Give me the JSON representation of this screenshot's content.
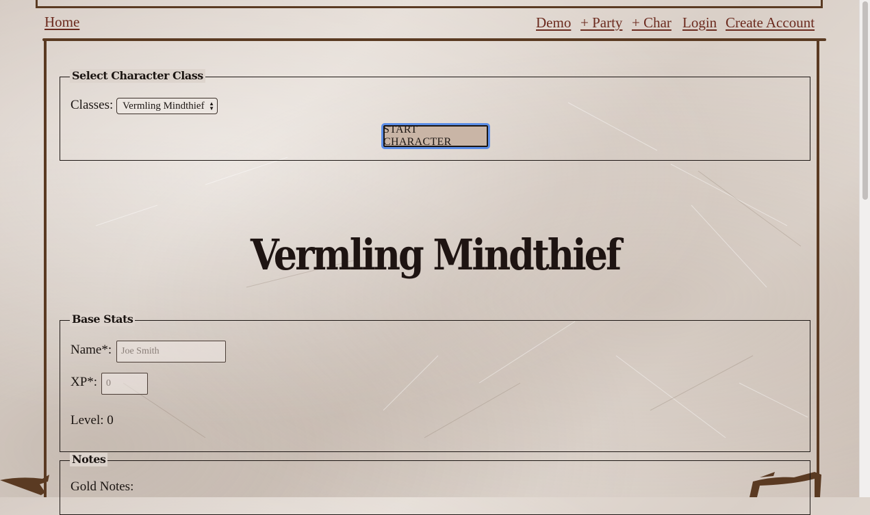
{
  "nav": {
    "home": "Home",
    "demo": "Demo",
    "party": "+ Party",
    "char": "+ Char",
    "login": "Login",
    "create_account": "Create Account"
  },
  "class_select": {
    "legend": "Select Character Class",
    "classes_label": "Classes:",
    "selected_class": "Vermling Mindthief",
    "start_button": "START CHARACTER"
  },
  "character_title": "Vermling Mindthief",
  "base_stats": {
    "legend": "Base Stats",
    "name_label": "Name*:",
    "name_placeholder": "Joe Smith",
    "xp_label": "XP*:",
    "xp_placeholder": "0",
    "level_text": "Level: 0"
  },
  "notes": {
    "legend": "Notes",
    "gold_notes_label": "Gold Notes:"
  },
  "colors": {
    "link": "#6b2a1e",
    "frame": "#5a3a22",
    "button_focus": "#5c8ee8",
    "button_bg": "#c9b5a6"
  }
}
